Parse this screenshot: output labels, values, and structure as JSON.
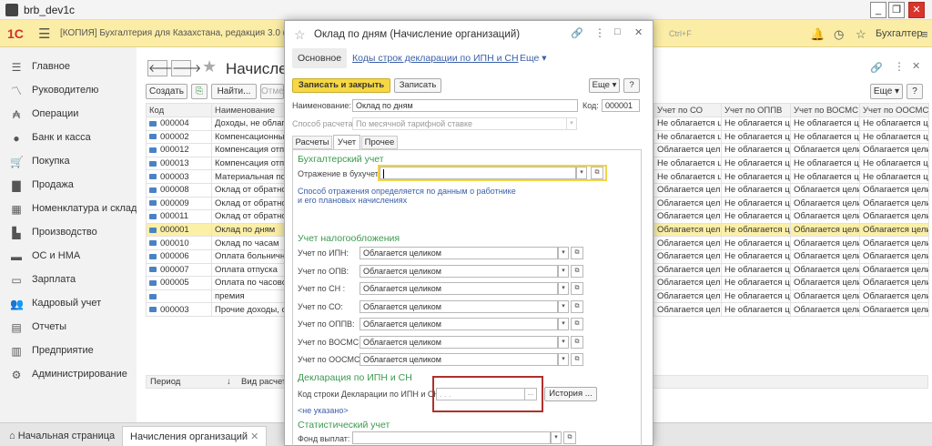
{
  "window": {
    "title": "brb_dev1c",
    "minimize": "_",
    "restore": "❐",
    "close": "✕"
  },
  "app": {
    "logo": "1С",
    "title": "[КОПИЯ] Бухгалтерия для Казахстана, редакция 3.0  (1С:Предприятие)",
    "user": "Бухгалтер",
    "search_hint": "Ctrl+F"
  },
  "sidebar": {
    "items": [
      {
        "label": "Главное",
        "icon": "menu-icon"
      },
      {
        "label": "Руководителю",
        "icon": "chart-icon"
      },
      {
        "label": "Операции",
        "icon": "operations-icon"
      },
      {
        "label": "Банк и касса",
        "icon": "bank-icon"
      },
      {
        "label": "Покупка",
        "icon": "cart-icon"
      },
      {
        "label": "Продажа",
        "icon": "bag-icon"
      },
      {
        "label": "Номенклатура и склад",
        "icon": "warehouse-icon"
      },
      {
        "label": "Производство",
        "icon": "factory-icon"
      },
      {
        "label": "ОС и НМА",
        "icon": "truck-icon"
      },
      {
        "label": "Зарплата",
        "icon": "money-icon"
      },
      {
        "label": "Кадровый учет",
        "icon": "people-icon"
      },
      {
        "label": "Отчеты",
        "icon": "report-icon"
      },
      {
        "label": "Предприятие",
        "icon": "building-icon"
      },
      {
        "label": "Администрирование",
        "icon": "gear-icon"
      }
    ]
  },
  "list": {
    "title": "Начисления организаций",
    "create": "Создать",
    "find": "Найти...",
    "cancel_search": "Отменить поиск",
    "more": "Еще",
    "columns": [
      "Код",
      "Наименование",
      "",
      "Учет по СО",
      "Учет по ОППВ",
      "Учет по ВОСМС",
      "Учет по ООСМС"
    ],
    "rows": [
      {
        "code": "000004",
        "name": "Доходы, не облагаемые",
        "so": "Не облагается цел...",
        "oppv": "Не облагается цел...",
        "vosms": "Не облагается цел...",
        "oosms": "Не облагается цел..."
      },
      {
        "code": "000002",
        "name": "Компенсационные выпл.",
        "so": "Не облагается цел...",
        "oppv": "Не облагается цел...",
        "vosms": "Не облагается цел...",
        "oosms": "Не облагается цел..."
      },
      {
        "code": "000012",
        "name": "Компенсация отпуска",
        "so": "Облагается целиком",
        "oppv": "Не облагается цел...",
        "vosms": "Облагается целиком",
        "oosms": "Облагается целиком"
      },
      {
        "code": "000013",
        "name": "Компенсация отпуска",
        "so": "Не облагается цел...",
        "oppv": "Не облагается цел...",
        "vosms": "Не облагается цел...",
        "oosms": "Не облагается цел..."
      },
      {
        "code": "000003",
        "name": "Материальная помощь",
        "so": "Не облагается цел...",
        "oppv": "Не облагается цел...",
        "vosms": "Не облагается цел...",
        "oosms": "Не облагается цел..."
      },
      {
        "code": "000008",
        "name": "Оклад от обратного",
        "so": "Облагается целиком",
        "oppv": "Не облагается цел...",
        "vosms": "Облагается целиком",
        "oosms": "Облагается целиком"
      },
      {
        "code": "000009",
        "name": "Оклад от обратного",
        "so": "Облагается целиком",
        "oppv": "Не облагается цел...",
        "vosms": "Облагается целиком",
        "oosms": "Облагается целиком"
      },
      {
        "code": "000011",
        "name": "Оклад от обратного",
        "so": "Облагается целиком",
        "oppv": "Не облагается цел...",
        "vosms": "Облагается целиком",
        "oosms": "Облагается целиком"
      },
      {
        "code": "000001",
        "name": "Оклад по дням",
        "so": "Облагается целиком",
        "oppv": "Не облагается цел...",
        "vosms": "Облагается целиком",
        "oosms": "Облагается целиком",
        "selected": true
      },
      {
        "code": "000010",
        "name": "Оклад по часам",
        "so": "Облагается целиком",
        "oppv": "Не облагается цел...",
        "vosms": "Облагается целиком",
        "oosms": "Облагается целиком"
      },
      {
        "code": "000006",
        "name": "Оплата больничных",
        "so": "Облагается целиком",
        "oppv": "Не облагается цел...",
        "vosms": "Облагается целиком",
        "oosms": "Облагается целиком"
      },
      {
        "code": "000007",
        "name": "Оплата отпуска",
        "so": "Облагается целиком",
        "oppv": "Не облагается цел...",
        "vosms": "Облагается целиком",
        "oosms": "Облагается целиком"
      },
      {
        "code": "000005",
        "name": "Оплата по часовому",
        "so": "Облагается целиком",
        "oppv": "Не облагается цел...",
        "vosms": "Облагается целиком",
        "oosms": "Облагается целиком"
      },
      {
        "code": "",
        "name": "премия",
        "so": "Облагается целиком",
        "oppv": "Не облагается цел...",
        "vosms": "Облагается целиком",
        "oosms": "Облагается целиком"
      },
      {
        "code": "000003",
        "name": "Прочие доходы, обл.",
        "so": "Облагается целиком",
        "oppv": "Не облагается цел...",
        "vosms": "Облагается целиком",
        "oosms": "Облагается целиком"
      }
    ],
    "lower_columns": [
      "Период",
      "↓",
      "Вид расчета"
    ]
  },
  "modal": {
    "title": "Оклад по дням (Начисление организаций)",
    "tabs_top": [
      "Основное",
      "Коды строк декларации по ИПН и СН",
      "Еще"
    ],
    "save_close": "Записать и закрыть",
    "save": "Записать",
    "more": "Еще",
    "help": "?",
    "name_label": "Наименование:",
    "name_value": "Оклад по дням",
    "code_label": "Код:",
    "code_value": "000001",
    "calc_label": "Способ расчета:",
    "calc_value": "По месячной тарифной ставке",
    "tabs": [
      "Расчеты",
      "Учет",
      "Прочее"
    ],
    "acc_section": "Бухгалтерский учет",
    "reflect_label": "Отражение в бухучете:",
    "reflect_value": "",
    "reflect_note": "Способ отражения определяется по данным о работнике и его плановых начислениях",
    "tax_section": "Учет налогообложения",
    "tax_rows": [
      {
        "label": "Учет по ИПН:",
        "value": "Облагается целиком"
      },
      {
        "label": "Учет по ОПВ:",
        "value": "Облагается целиком"
      },
      {
        "label": "Учет по СН :",
        "value": "Облагается целиком"
      },
      {
        "label": "Учет по СО:",
        "value": "Облагается целиком"
      },
      {
        "label": "Учет по ОППВ:",
        "value": "Облагается целиком"
      },
      {
        "label": "Учет по ВОСМС:",
        "value": "Облагается целиком"
      },
      {
        "label": "Учет по ООСМС:",
        "value": "Облагается целиком"
      }
    ],
    "decl_section": "Декларация по ИПН и СН",
    "decl_label": "Код строки Декларации по ИПН и СН:",
    "decl_value": "  .  .  .",
    "history": "История ...",
    "not_set": "<не указано>",
    "stat_section": "Статистический учет",
    "fund_label": "Фонд выплат:",
    "fund_value": ""
  },
  "bottom": {
    "home": "Начальная страница",
    "tab": "Начисления организаций"
  },
  "colors": {
    "header": "#fbeda6",
    "selected_row": "#fcefa7",
    "accent_button": "#f7d844",
    "section_green": "#3b9a4f",
    "highlight_red": "#b0302b"
  }
}
